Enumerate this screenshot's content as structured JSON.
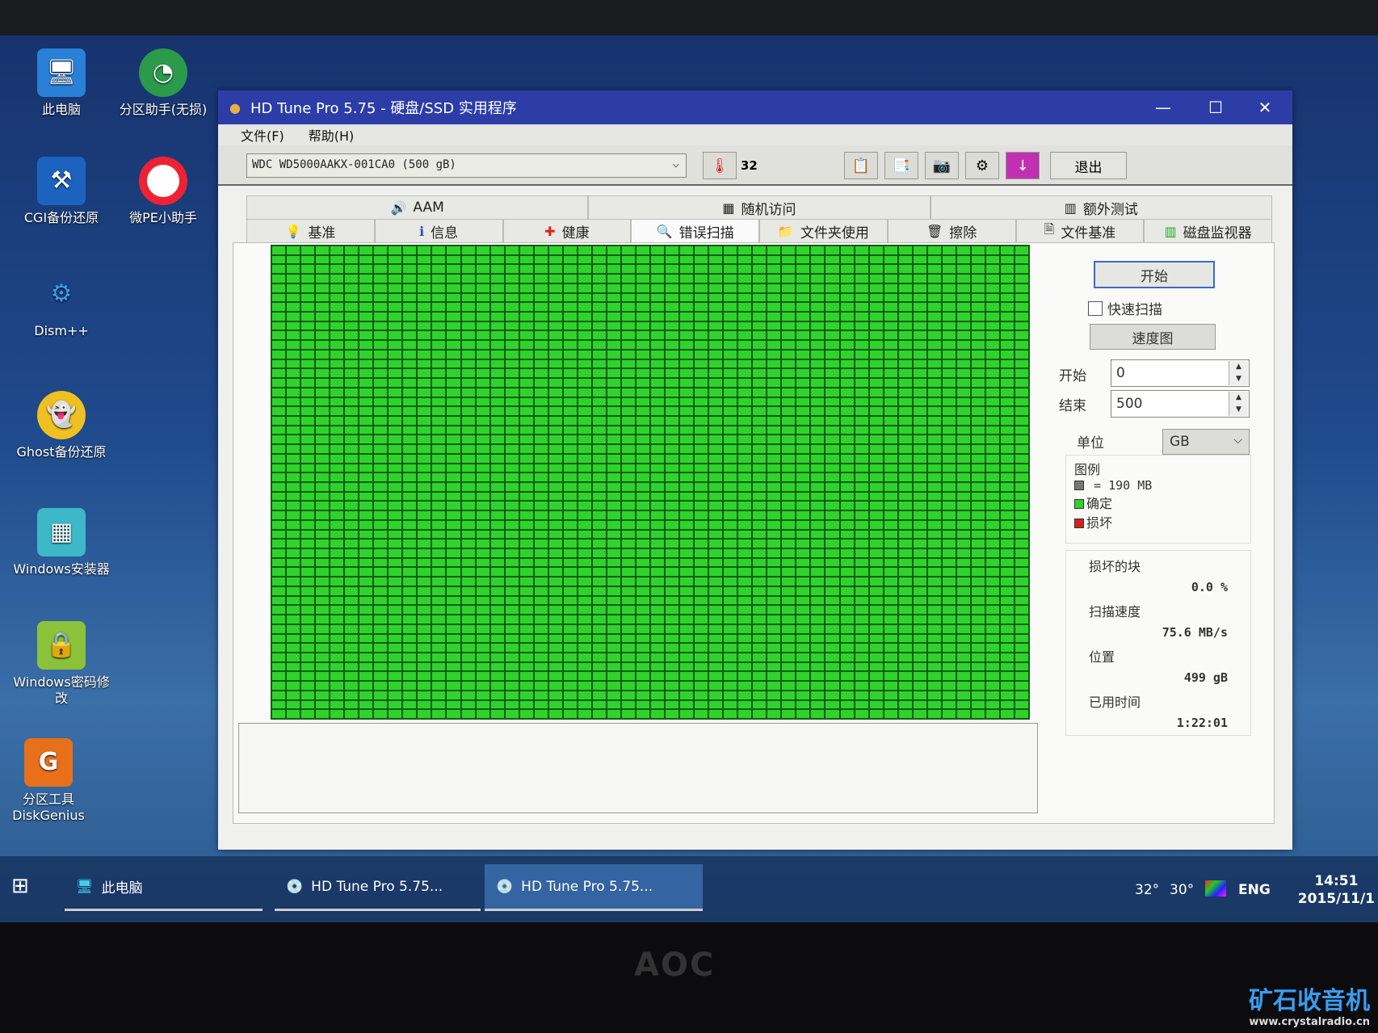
{
  "desktop_icons": [
    {
      "label": "此电脑",
      "icon": "computer-icon"
    },
    {
      "label": "分区助手(无损)",
      "icon": "partition-assistant-icon"
    },
    {
      "label": "CGI备份还原",
      "icon": "cgi-backup-icon"
    },
    {
      "label": "微PE小助手",
      "icon": "lifebuoy-icon"
    },
    {
      "label": "Dism++",
      "icon": "gears-icon"
    },
    {
      "label": "Ghost备份还原",
      "icon": "ghost-icon"
    },
    {
      "label": "Windows安装器",
      "icon": "windows-installer-icon"
    },
    {
      "label": "Windows密码修改",
      "icon": "lock-icon"
    },
    {
      "label": "分区工具DiskGenius",
      "icon": "diskgenius-icon"
    }
  ],
  "window": {
    "title": "HD Tune Pro 5.75 - 硬盘/SSD 实用程序",
    "menu": [
      "文件(F)",
      "帮助(H)"
    ],
    "drive": "WDC WD5000AAKX-001CA0 (500 gB)",
    "temperature": "32",
    "exit_label": "退出",
    "tabs_top": [
      "AAM",
      "随机访问",
      "额外测试"
    ],
    "tabs_bottom": [
      "基准",
      "信息",
      "健康",
      "错误扫描",
      "文件夹使用",
      "擦除",
      "文件基准",
      "磁盘监视器"
    ],
    "active_tab": "错误扫描"
  },
  "scan": {
    "start_button": "开始",
    "quick_scan_label": "快速扫描",
    "quick_scan_checked": false,
    "speed_map_button": "速度图",
    "start_label": "开始",
    "start_value": "0",
    "end_label": "结束",
    "end_value": "500",
    "unit_label": "单位",
    "unit_value": "GB",
    "legend_title": "图例",
    "legend_block": "= 190 MB",
    "legend_ok": "确定",
    "legend_bad": "损坏",
    "damaged_label": "损坏的块",
    "damaged_value": "0.0 %",
    "speed_label": "扫描速度",
    "speed_value": "75.6 MB/s",
    "position_label": "位置",
    "position_value": "499 gB",
    "elapsed_label": "已用时间",
    "elapsed_value": "1:22:01",
    "map": {
      "columns": 52,
      "rows": 50,
      "ok_blocks": 2600,
      "bad_blocks": 0
    },
    "colors": {
      "ok": "#2fd32c",
      "bad": "#d42020",
      "block": "#777777"
    }
  },
  "taskbar": {
    "items": [
      "此电脑",
      "HD Tune Pro 5.75...",
      "HD Tune Pro 5.75..."
    ],
    "temps": [
      "32°",
      "30°"
    ],
    "lang": "ENG",
    "time": "14:51",
    "date": "2015/11/1"
  },
  "monitor_brand": "AOC",
  "watermark": {
    "title": "矿石收音机",
    "url": "www.crystalradio.cn"
  }
}
